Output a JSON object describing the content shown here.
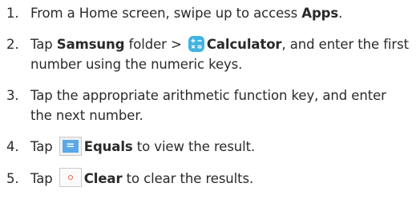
{
  "steps": [
    {
      "num": "1.",
      "text_a": "From a Home screen, swipe up to access ",
      "bold_a": "Apps",
      "text_b": "."
    },
    {
      "num": "2.",
      "text_a": "Tap ",
      "bold_a": "Samsung",
      "text_b": " folder > ",
      "icon": "calculator-app-icon",
      "bold_b": "Calculator",
      "text_c": ", and enter the first number using the numeric keys."
    },
    {
      "num": "3.",
      "text_a": "Tap the appropriate arithmetic function key, and enter the next number."
    },
    {
      "num": "4.",
      "text_a": "Tap ",
      "icon": "equals-key-icon",
      "bold_a": "Equals",
      "text_b": " to view the result."
    },
    {
      "num": "5.",
      "text_a": "Tap ",
      "icon": "clear-key-icon",
      "bold_a": "Clear",
      "text_b": " to clear the results."
    }
  ],
  "icons": {
    "equals_glyph": "=",
    "calculator_color": "#3fb4e0",
    "equals_color": "#5aa9e6",
    "clear_color": "#e06a4a"
  }
}
